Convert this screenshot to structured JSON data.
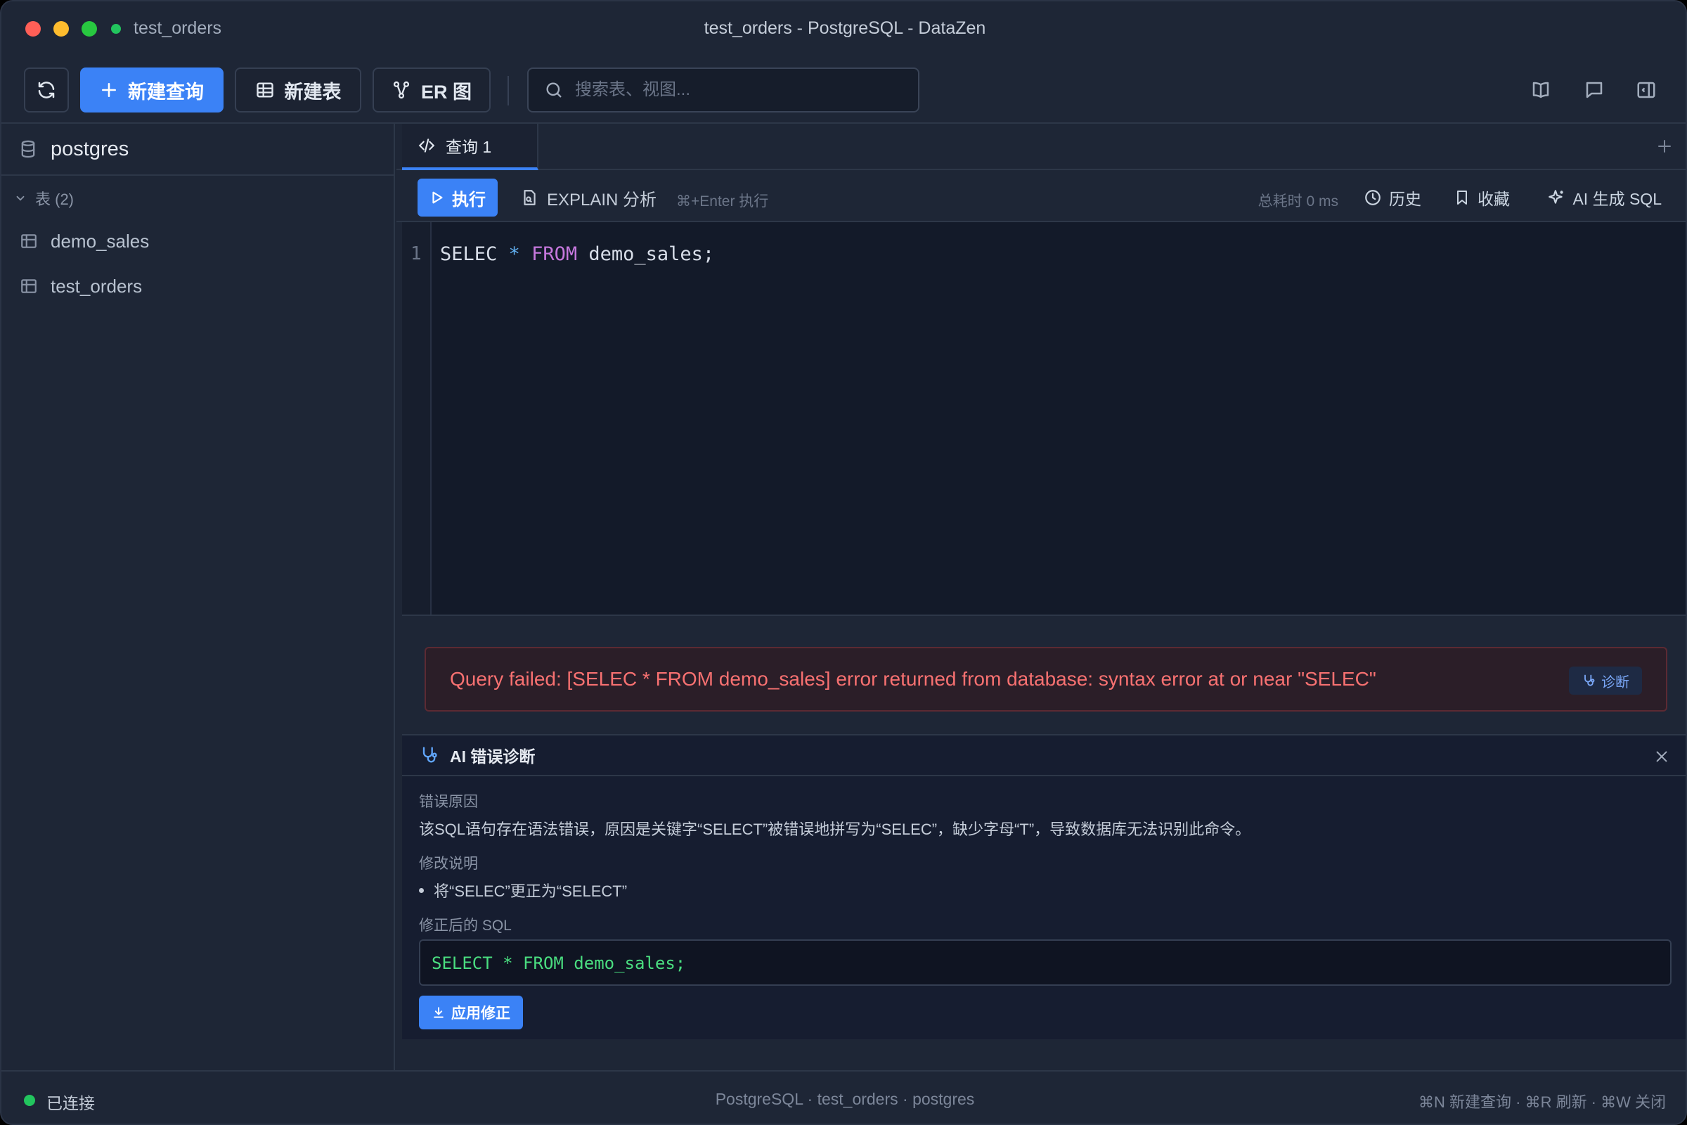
{
  "window": {
    "title_left": "test_orders",
    "title": "test_orders - PostgreSQL - DataZen"
  },
  "toolbar": {
    "new_query_label": "新建查询",
    "new_table_label": "新建表",
    "er_label": "ER 图",
    "search_placeholder": "搜索表、视图..."
  },
  "sidebar": {
    "database": "postgres",
    "group_label": "表 (2)",
    "tables": [
      "demo_sales",
      "test_orders"
    ]
  },
  "tabs": [
    {
      "label": "查询 1"
    }
  ],
  "query_bar": {
    "run_label": "执行",
    "explain_label": "EXPLAIN 分析",
    "shortcut_hint": "⌘+Enter 执行",
    "elapsed": "总耗时 0 ms",
    "history_label": "历史",
    "favorites_label": "收藏",
    "ai_sql_label": "AI 生成 SQL"
  },
  "editor": {
    "line_number": "1",
    "code_tokens": {
      "t1": "SELEC ",
      "t2": "*",
      "t3": " ",
      "t4": "FROM",
      "t5": " demo_sales;"
    }
  },
  "error": {
    "message": "Query failed: [SELEC * FROM demo_sales] error returned from database: syntax error at or near \"SELEC\"",
    "diagnose_label": "诊断"
  },
  "ai_panel": {
    "title": "AI 错误诊断",
    "cause_label": "错误原因",
    "cause_text": "该SQL语句存在语法错误，原因是关键字“SELECT”被错误地拼写为“SELEC”，缺少字母“T”，导致数据库无法识别此命令。",
    "fix_label": "修改说明",
    "fix_items": [
      "将“SELEC”更正为“SELECT”"
    ],
    "corrected_label": "修正后的 SQL",
    "corrected_sql": "SELECT * FROM demo_sales;",
    "apply_label": "应用修正"
  },
  "status": {
    "connection": "已连接",
    "center": "PostgreSQL · test_orders · postgres",
    "shortcuts": "⌘N 新建查询 · ⌘R 刷新 · ⌘W 关闭"
  },
  "colors": {
    "accent": "#3b82f6",
    "error": "#f87171",
    "success": "#22c55e",
    "keyword": "#c678dd",
    "fixed_sql": "#4ade80"
  }
}
